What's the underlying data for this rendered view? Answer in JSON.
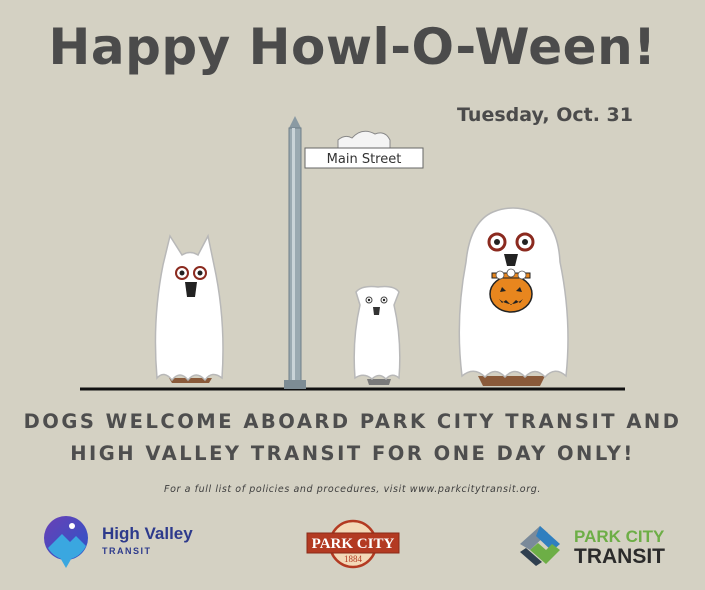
{
  "title": "Happy Howl-O-Ween!",
  "date": "Tuesday, Oct. 31",
  "street_sign": "Main Street",
  "headline_line1": "DOGS WELCOME ABOARD PARK CITY TRANSIT AND",
  "headline_line2": "HIGH VALLEY TRANSIT FOR ONE DAY ONLY!",
  "note": "For a full list of policies and procedures, visit www.parkcitytransit.org.",
  "logos": {
    "high_valley_name": "High Valley",
    "high_valley_sub": "TRANSIT",
    "park_city_badge": "PARK CITY",
    "park_city_year": "1884",
    "park_city_transit_name": "PARK CITY",
    "park_city_transit_sub": "TRANSIT"
  },
  "colors": {
    "background": "#d4d1c3",
    "text": "#4b4b4b",
    "high_valley_blue": "#2d3a8c",
    "park_city_red": "#b33a22",
    "park_city_transit_green": "#6dae46",
    "pumpkin_orange": "#e8861e"
  }
}
